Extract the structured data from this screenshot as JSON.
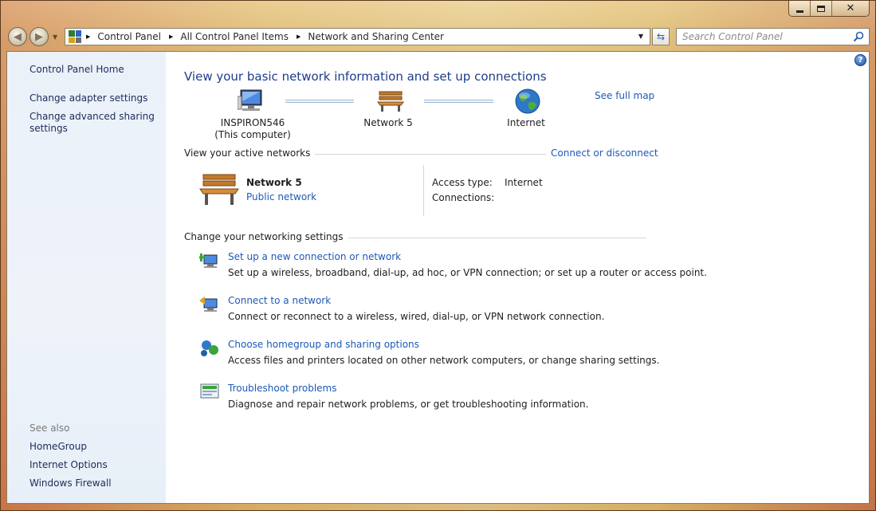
{
  "window": {
    "caption_buttons": [
      "minimize",
      "maximize",
      "close"
    ]
  },
  "address": {
    "crumbs": [
      "Control Panel",
      "All Control Panel Items",
      "Network and Sharing Center"
    ]
  },
  "search": {
    "placeholder": "Search Control Panel"
  },
  "sidebar": {
    "items": [
      {
        "label": "Control Panel Home"
      },
      {
        "label": "Change adapter settings"
      },
      {
        "label": "Change advanced sharing settings"
      }
    ],
    "see_also_label": "See also",
    "see_also": [
      {
        "label": "HomeGroup"
      },
      {
        "label": "Internet Options"
      },
      {
        "label": "Windows Firewall"
      }
    ]
  },
  "main": {
    "title": "View your basic network information and set up connections",
    "see_full_map": "See full map",
    "map": {
      "computer_name": "INSPIRON546",
      "computer_sub": "(This computer)",
      "network_name": "Network  5",
      "internet": "Internet"
    },
    "active_networks": {
      "header": "View your active networks",
      "connect_link": "Connect or disconnect",
      "network_name": "Network  5",
      "network_type": "Public network",
      "access_type_label": "Access type:",
      "access_type_value": "Internet",
      "connections_label": "Connections:"
    },
    "settings": {
      "header": "Change your networking settings",
      "tasks": [
        {
          "title": "Set up a new connection or network",
          "desc": "Set up a wireless, broadband, dial-up, ad hoc, or VPN connection; or set up a router or access point."
        },
        {
          "title": "Connect to a network",
          "desc": "Connect or reconnect to a wireless, wired, dial-up, or VPN network connection."
        },
        {
          "title": "Choose homegroup and sharing options",
          "desc": "Access files and printers located on other network computers, or change sharing settings."
        },
        {
          "title": "Troubleshoot problems",
          "desc": "Diagnose and repair network problems, or get troubleshooting information."
        }
      ]
    }
  },
  "colors": {
    "link": "#1e59b6",
    "title": "#1e3c8c",
    "sidebar_bg": "#ebf1f9"
  }
}
